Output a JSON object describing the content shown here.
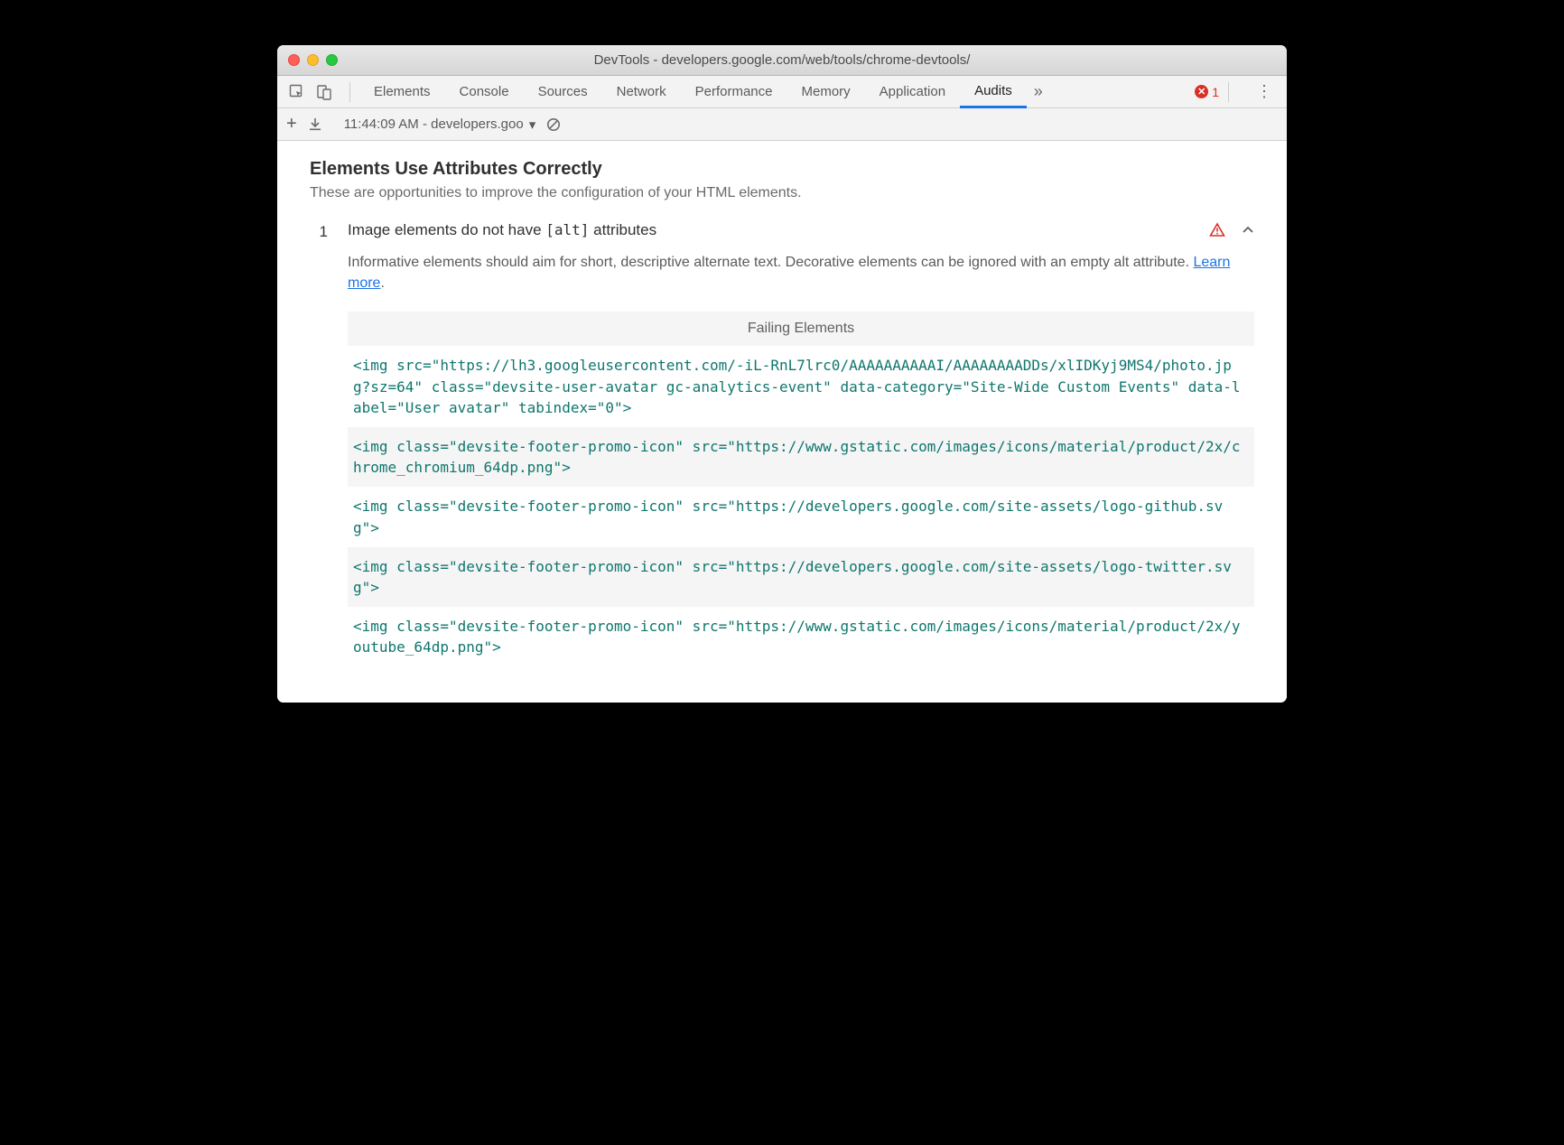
{
  "window": {
    "title": "DevTools - developers.google.com/web/tools/chrome-devtools/"
  },
  "tabs": {
    "items": [
      "Elements",
      "Console",
      "Sources",
      "Network",
      "Performance",
      "Memory",
      "Application",
      "Audits"
    ],
    "active": "Audits",
    "error_count": "1"
  },
  "toolbar": {
    "run_label": "11:44:09 AM - developers.goo"
  },
  "section": {
    "title": "Elements Use Attributes Correctly",
    "subtitle": "These are opportunities to improve the configuration of your HTML elements."
  },
  "audit": {
    "number": "1",
    "title_pre": "Image elements do not have ",
    "title_code": "[alt]",
    "title_post": " attributes",
    "desc_pre": "Informative elements should aim for short, descriptive alternate text. Decorative elements can be ignored with an empty alt attribute. ",
    "learn_more": "Learn more",
    "desc_post": ".",
    "failing_header": "Failing Elements",
    "elements": [
      "<img src=\"https://lh3.googleusercontent.com/-iL-RnL7lrc0/AAAAAAAAAAI/AAAAAAAADDs/xlIDKyj9MS4/photo.jpg?sz=64\" class=\"devsite-user-avatar gc-analytics-event\" data-category=\"Site-Wide Custom Events\" data-label=\"User avatar\" tabindex=\"0\">",
      "<img class=\"devsite-footer-promo-icon\" src=\"https://www.gstatic.com/images/icons/material/product/2x/chrome_chromium_64dp.png\">",
      "<img class=\"devsite-footer-promo-icon\" src=\"https://developers.google.com/site-assets/logo-github.svg\">",
      "<img class=\"devsite-footer-promo-icon\" src=\"https://developers.google.com/site-assets/logo-twitter.svg\">",
      "<img class=\"devsite-footer-promo-icon\" src=\"https://www.gstatic.com/images/icons/material/product/2x/youtube_64dp.png\">"
    ]
  }
}
